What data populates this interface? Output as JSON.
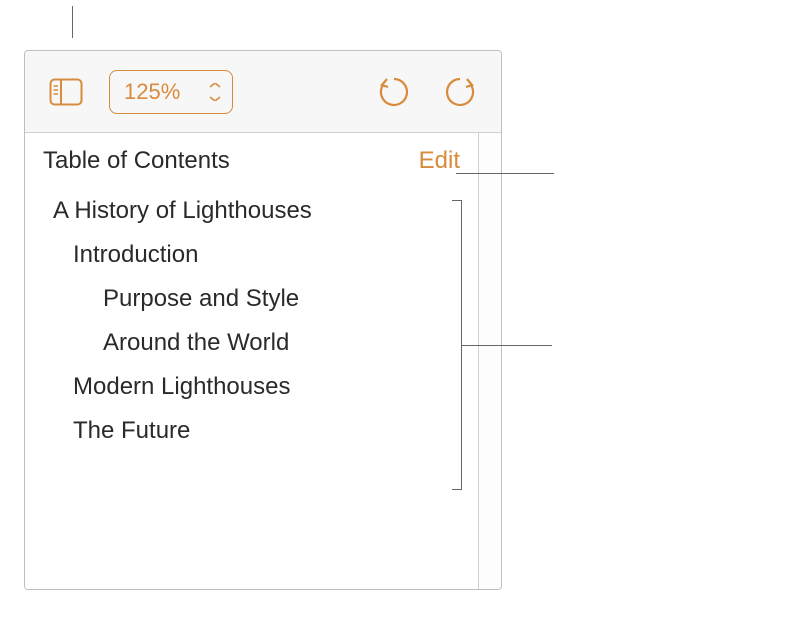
{
  "toolbar": {
    "zoom": "125%"
  },
  "toc": {
    "title": "Table of Contents",
    "edit_label": "Edit",
    "items": [
      {
        "label": "A History of Lighthouses",
        "level": 0
      },
      {
        "label": "Introduction",
        "level": 1
      },
      {
        "label": "Purpose and Style",
        "level": 2
      },
      {
        "label": "Around the World",
        "level": 2
      },
      {
        "label": "Modern Lighthouses",
        "level": 1
      },
      {
        "label": "The Future",
        "level": 1
      }
    ]
  },
  "colors": {
    "accent": "#d78b3b"
  }
}
